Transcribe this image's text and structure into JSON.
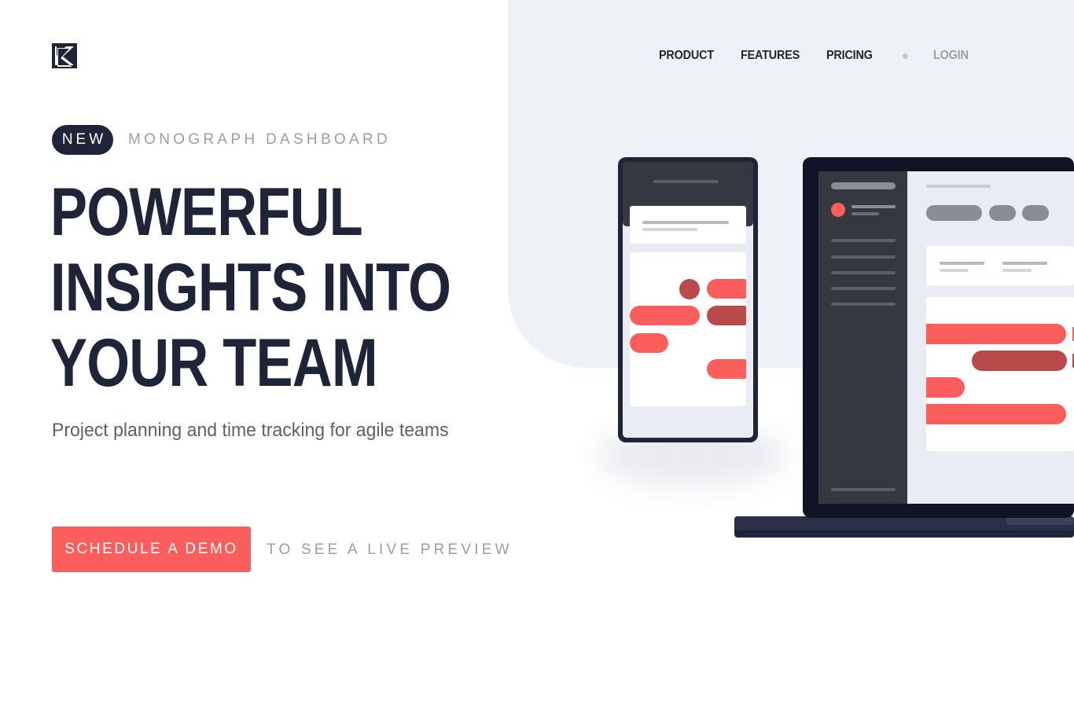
{
  "header": {
    "logo": "monograph-logo-icon",
    "nav": {
      "product": "PRODUCT",
      "features": "FEATURES",
      "pricing": "PRICING",
      "login": "LOGIN"
    }
  },
  "hero": {
    "badge": "NEW",
    "eyebrow": "MONOGRAPH DASHBOARD",
    "headline": [
      "POWERFUL",
      "INSIGHTS INTO",
      "YOUR TEAM"
    ],
    "subtitle": "Project planning and time tracking for agile teams",
    "cta_label": "SCHEDULE A DEMO",
    "cta_caption": "TO SEE A LIVE PREVIEW"
  },
  "colors": {
    "navy": "#1f2438",
    "accent": "#fc5e5e",
    "accent_dark": "#ba4949",
    "muted": "#9a9daa",
    "panel": "#eef2f6"
  }
}
